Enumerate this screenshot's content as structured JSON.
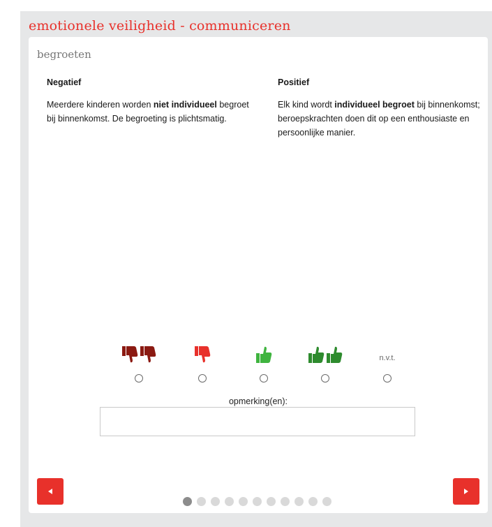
{
  "section_title": "emotionele veiligheid - communiceren",
  "card": {
    "title": "begroeten",
    "negative": {
      "heading": "Negatief",
      "text_before": "Meerdere kinderen worden ",
      "text_bold": "niet individueel",
      "text_after": " begroet bij binnenkomst. De begroeting is plichtsmatig."
    },
    "positive": {
      "heading": "Positief",
      "text_before": "Elk kind wordt ",
      "text_bold": "individueel begroet",
      "text_after": " bij binnenkomst; beroepskrachten doen dit op een enthousiaste en persoonlijke manier."
    }
  },
  "rating": {
    "options": [
      {
        "icon": "double-thumbs-down-icon",
        "color": "#8b1a12"
      },
      {
        "icon": "thumbs-down-icon",
        "color": "#e8312b"
      },
      {
        "icon": "thumbs-up-icon",
        "color": "#3fb43f"
      },
      {
        "icon": "double-thumbs-up-icon",
        "color": "#2e8b2e"
      },
      {
        "label": "n.v.t."
      }
    ],
    "selected": null
  },
  "remark": {
    "label": "opmerking(en):",
    "value": ""
  },
  "pagination": {
    "total": 11,
    "current": 1
  },
  "colors": {
    "accent": "#e8312b",
    "dark_red": "#8b1a12",
    "light_green": "#3fb43f",
    "dark_green": "#2e8b2e"
  }
}
